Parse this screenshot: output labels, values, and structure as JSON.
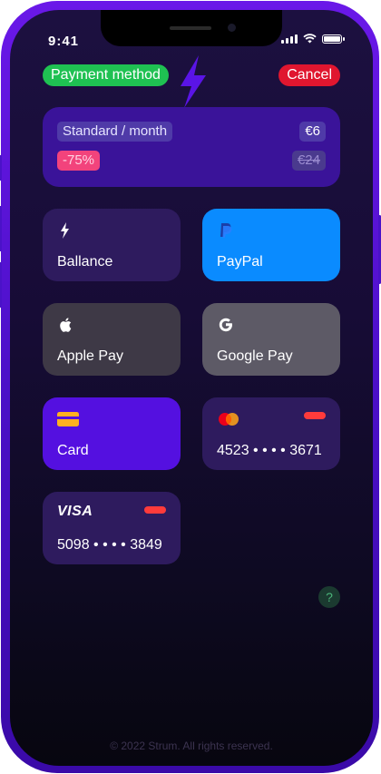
{
  "status_bar": {
    "time": "9:41"
  },
  "header": {
    "title": "Payment method",
    "cancel_label": "Cancel"
  },
  "plan": {
    "name": "Standard / month",
    "price": "€6",
    "discount": "-75%",
    "old_price": "€24"
  },
  "methods": {
    "balance": "Ballance",
    "paypal": "PayPal",
    "apple_pay": "Apple Pay",
    "google_pay": "Google Pay",
    "card": "Card",
    "mastercard_number": "4523 • • • • 3671",
    "visa_brand": "VISA",
    "visa_number": "5098 • • • • 3849"
  },
  "help": {
    "label": "?"
  },
  "footer": {
    "copyright": "© 2022 Strum. All rights reserved."
  },
  "colors": {
    "accent_green": "#1fc152",
    "accent_red": "#e0162f",
    "paypal_blue": "#0a8bff",
    "card_purple": "#5410e0",
    "discount_pink": "#f2437c"
  },
  "icons": {
    "balance": "bolt-icon",
    "paypal": "paypal-icon",
    "apple_pay": "apple-icon",
    "google_pay": "google-icon",
    "card": "card-icon",
    "mastercard": "mastercard-icon"
  }
}
